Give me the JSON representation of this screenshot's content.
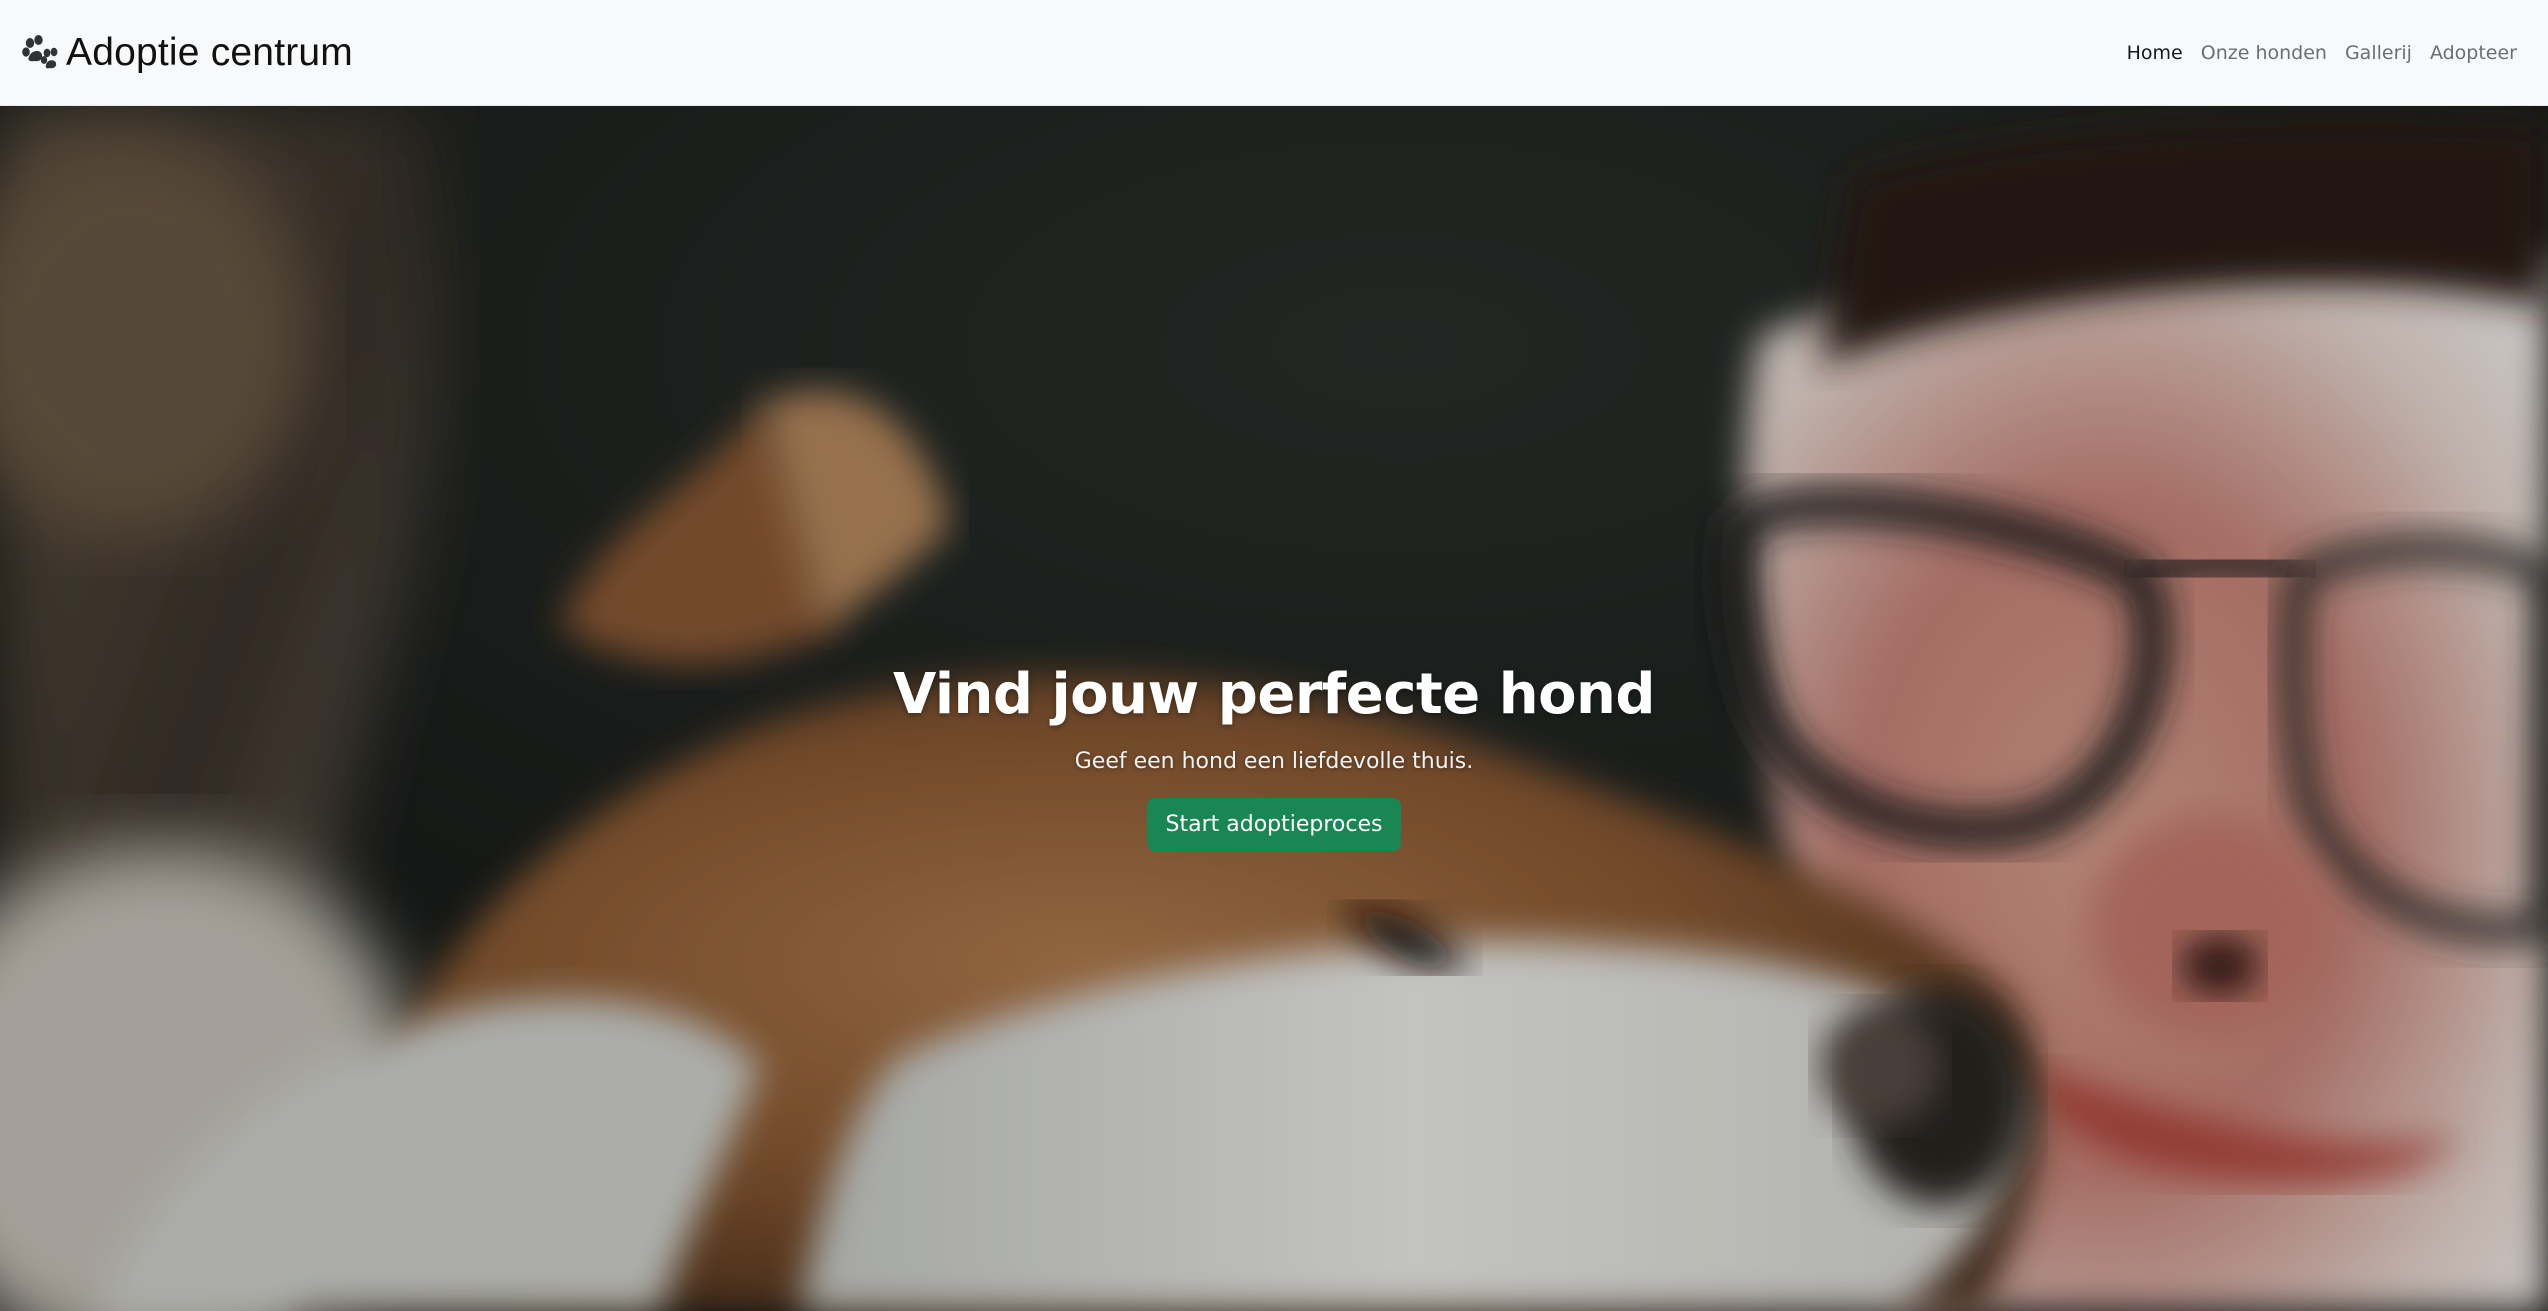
{
  "navbar": {
    "brand": {
      "icon": "paw-icon",
      "title": "Adoptie centrum"
    },
    "links": [
      {
        "label": "Home",
        "active": true
      },
      {
        "label": "Onze honden",
        "active": false
      },
      {
        "label": "Gallerij",
        "active": false
      },
      {
        "label": "Adopteer",
        "active": false
      }
    ]
  },
  "hero": {
    "title": "Vind jouw perfecte hond",
    "subtitle": "Geef een hond een liefdevolle thuis.",
    "cta_label": "Start adoptieproces",
    "image": "dog-and-woman-photo"
  },
  "colors": {
    "navbar_bg": "#f8f9fa",
    "cta_green": "#198754",
    "link_active": "#16191c",
    "link_inactive": "#6b6f73"
  }
}
